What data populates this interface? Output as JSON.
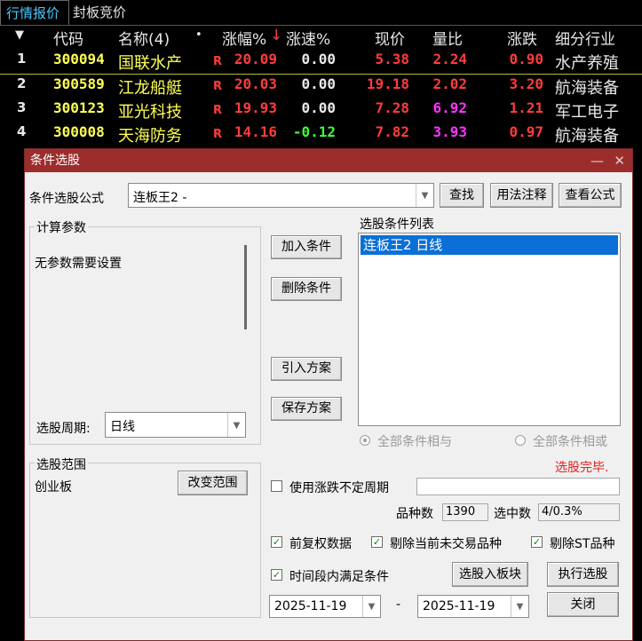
{
  "tabs": [
    "行情报价",
    "封板竞价"
  ],
  "table": {
    "headers": {
      "code": "代码",
      "name": "名称(4)",
      "dot": "•",
      "pct": "涨幅%",
      "sort_arrow": "↓",
      "speed": "涨速%",
      "price": "现价",
      "vol_ratio": "量比",
      "change": "涨跌",
      "industry": "细分行业"
    },
    "rows": [
      {
        "idx": "1",
        "code": "300094",
        "name": "国联水产",
        "flag": "R",
        "pct": "20.09",
        "speed": "0.00",
        "price": "5.38",
        "vol_ratio": "2.24",
        "change": "0.90",
        "industry": "水产养殖"
      },
      {
        "idx": "2",
        "code": "300589",
        "name": "江龙船艇",
        "flag": "R",
        "pct": "20.03",
        "speed": "0.00",
        "price": "19.18",
        "vol_ratio": "2.02",
        "change": "3.20",
        "industry": "航海装备"
      },
      {
        "idx": "3",
        "code": "300123",
        "name": "亚光科技",
        "flag": "R",
        "pct": "19.93",
        "speed": "0.00",
        "price": "7.28",
        "vol_ratio": "6.92",
        "change": "1.21",
        "industry": "军工电子"
      },
      {
        "idx": "4",
        "code": "300008",
        "name": "天海防务",
        "flag": "R",
        "pct": "14.16",
        "speed": "-0.12",
        "price": "7.82",
        "vol_ratio": "3.93",
        "change": "0.97",
        "industry": "航海装备"
      }
    ]
  },
  "dialog": {
    "title": "条件选股",
    "min_glyph": "—",
    "close_glyph": "✕",
    "formula_label": "条件选股公式",
    "formula_value": "连板王2  -",
    "btn_find": "查找",
    "btn_usage": "用法注释",
    "btn_view": "查看公式",
    "params_group": "计算参数",
    "params_text": "无参数需要设置",
    "period_label": "选股周期:",
    "period_value": "日线",
    "btn_add": "加入条件",
    "btn_delete": "删除条件",
    "btn_import": "引入方案",
    "btn_save": "保存方案",
    "cond_list_label": "选股条件列表",
    "cond_items": [
      "连板王2  日线"
    ],
    "radio_and": "全部条件相与",
    "radio_or": "全部条件相或",
    "status": "选股完毕.",
    "range_group": "选股范围",
    "range_value": "创业板",
    "btn_change_range": "改变范围",
    "use_variable_period": "使用涨跌不定周期",
    "variety_label": "品种数",
    "variety_count": "1390",
    "selected_label": "选中数",
    "selected_value": "4/0.3%",
    "chk_fq": "前复权数据",
    "chk_excl_untraded": "剔除当前未交易品种",
    "chk_excl_st": "剔除ST品种",
    "chk_time_range": "时间段内满足条件",
    "btn_to_block": "选股入板块",
    "btn_execute": "执行选股",
    "date_start": "2025-11-19",
    "date_sep": "-",
    "date_end": "2025-11-19",
    "btn_close": "关闭",
    "colors": {
      "title_bar": "#9c2d2d",
      "status_red": "#e02020",
      "selection": "#0a6fd6"
    }
  }
}
